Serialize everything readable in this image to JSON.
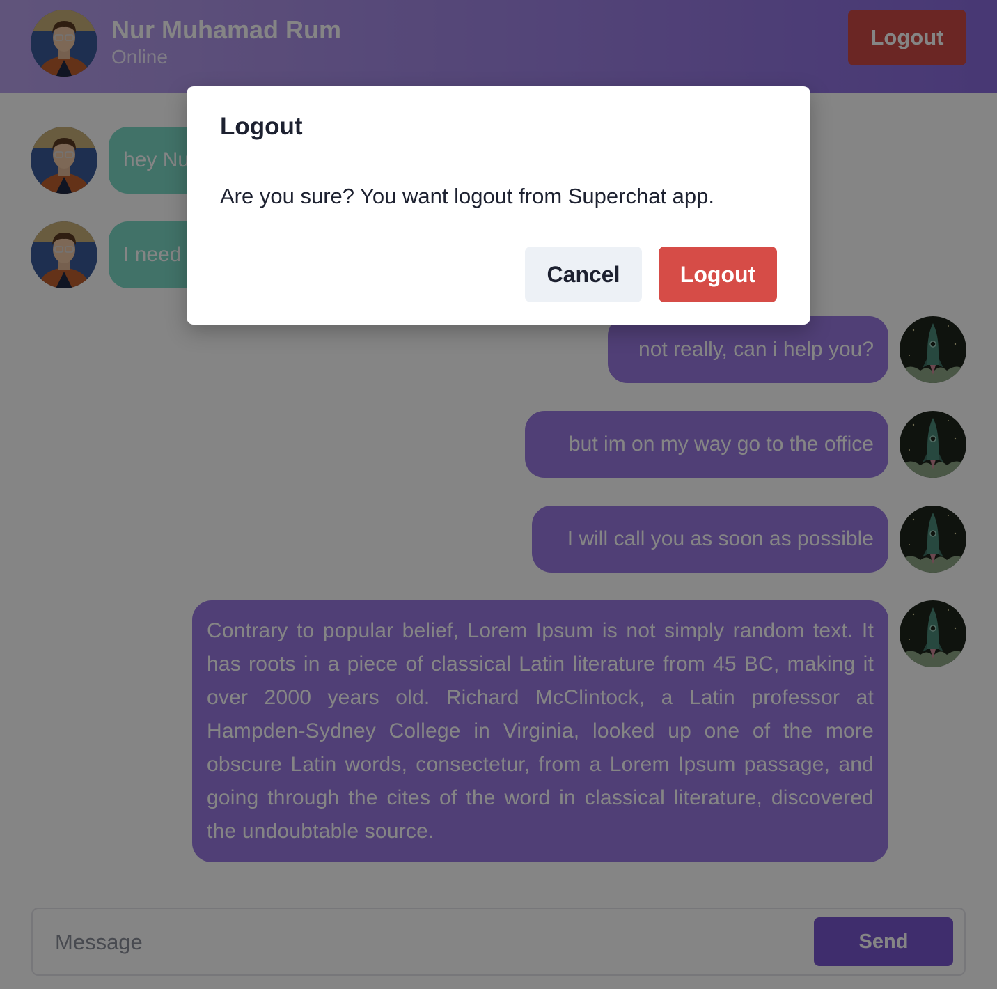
{
  "header": {
    "contact_name": "Nur Muhamad Rum",
    "contact_status": "Online",
    "logout_label": "Logout"
  },
  "messages": [
    {
      "side": "incoming",
      "text": "hey Nu"
    },
    {
      "side": "incoming",
      "text": "I need"
    },
    {
      "side": "outgoing",
      "text": "not really, can i help you?"
    },
    {
      "side": "outgoing",
      "text": "but im on my way go to the office"
    },
    {
      "side": "outgoing",
      "text": "I will call you as soon as possible"
    },
    {
      "side": "outgoing",
      "text": "Contrary to popular belief, Lorem Ipsum is not simply random text. It has roots in a piece of classical Latin literature from 45 BC, making it over 2000 years old. Richard McClintock, a Latin professor at Hampden-Sydney College in Virginia, looked up one of the more obscure Latin words, consectetur, from a Lorem Ipsum passage, and going through the cites of the word in classical literature, discovered the undoubtable source."
    }
  ],
  "composer": {
    "placeholder": "Message",
    "send_label": "Send"
  },
  "modal": {
    "title": "Logout",
    "body": "Are you sure? You want logout from Superchat app.",
    "cancel_label": "Cancel",
    "confirm_label": "Logout"
  },
  "colors": {
    "header_gradient_start": "#b9a2ec",
    "header_gradient_end": "#8a6bdf",
    "incoming_bubble": "#7ddac8",
    "outgoing_bubble": "#9a7ae2",
    "danger": "#d64c47",
    "send_button": "#7a56d2",
    "cancel_button": "#edf1f6"
  }
}
